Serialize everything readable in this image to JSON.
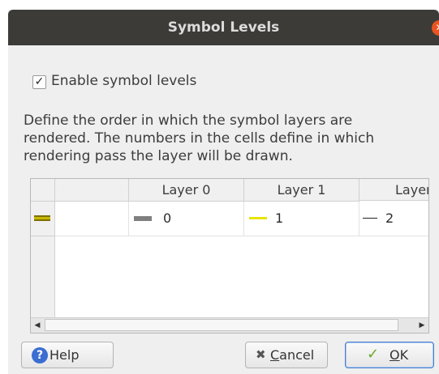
{
  "window": {
    "title": "Symbol Levels",
    "close_icon": "close-icon"
  },
  "options": {
    "enable_symbol_levels": {
      "label": "Enable symbol levels",
      "checked": true,
      "check_glyph": "✓"
    }
  },
  "description": {
    "lines": [
      "Define the order in which the symbol layers are",
      "rendered. The numbers in the cells define in which",
      "rendering pass the layer will be drawn."
    ]
  },
  "table": {
    "columns": [
      "Layer 0",
      "Layer 1",
      "Layer"
    ],
    "rows": [
      {
        "symbol_icon": "line-symbol-icon",
        "cells": [
          {
            "swatch": "gray-line-swatch",
            "color": "#7f7f7f",
            "value": "0"
          },
          {
            "swatch": "yellow-line-swatch",
            "color": "#e8e400",
            "value": "1"
          },
          {
            "swatch": "black-line-swatch",
            "color": "#222222",
            "value": "2"
          }
        ]
      }
    ],
    "scrollbar": {
      "left_arrow": "◀",
      "right_arrow": "▶"
    }
  },
  "buttons": {
    "help": {
      "label": "Help",
      "icon_glyph": "?"
    },
    "cancel": {
      "label_underlined": "C",
      "label_rest": "ancel",
      "icon_glyph": "✖"
    },
    "ok": {
      "label_underlined": "O",
      "label_rest": "K",
      "icon_glyph": "✓"
    }
  },
  "colors": {
    "titlebar": "#3c3b37",
    "close_button": "#e95420",
    "dialog_background": "#efefef",
    "help_icon": "#3b6ed1",
    "ok_icon": "#6aa82a"
  }
}
